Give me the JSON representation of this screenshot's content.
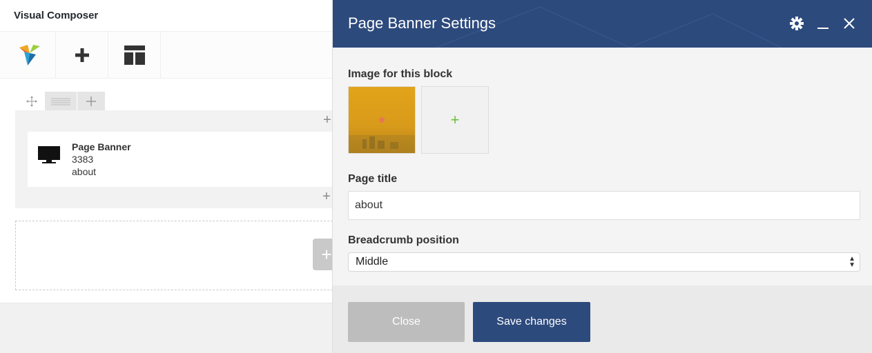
{
  "app": {
    "title": "Visual Composer"
  },
  "toolbar": {
    "logo_icon": "vc-logo-icon",
    "add_icon": "plus-icon",
    "templates_icon": "layout-icon"
  },
  "row": {
    "move_icon": "move-icon",
    "columns_icon": "columns-icon",
    "add_icon": "plus-icon",
    "top_add": "+",
    "bottom_add": "+",
    "element": {
      "icon": "monitor-icon",
      "name": "Page Banner",
      "line2": "3383",
      "line3": "about"
    }
  },
  "empty_zone": {
    "add": "+"
  },
  "modal": {
    "title": "Page Banner Settings",
    "header_colors": {
      "background": "#2d4a7d"
    },
    "image_label": "Image for this block",
    "image_add": "+",
    "page_title_label": "Page title",
    "page_title_value": "about",
    "breadcrumb_label": "Breadcrumb position",
    "breadcrumb_value": "Middle",
    "close_label": "Close",
    "save_label": "Save changes"
  }
}
